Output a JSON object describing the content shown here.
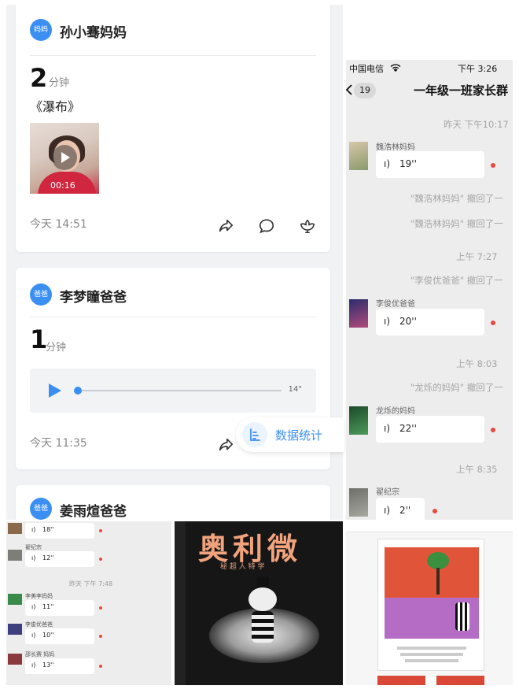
{
  "feed": {
    "posts": [
      {
        "badge": "妈妈",
        "author": "孙小骞妈妈",
        "duration": "2",
        "duration_unit": "分钟",
        "work_title": "《瀑布》",
        "video_time": "00:16",
        "time": "今天 14:51"
      },
      {
        "badge": "爸爸",
        "author": "李梦瞳爸爸",
        "duration": "1",
        "duration_unit": "分钟",
        "audio_length": "14\"",
        "time": "今天 11:35"
      },
      {
        "badge": "爸爸",
        "author": "姜雨煊爸爸"
      }
    ],
    "stats_label": "数据统计"
  },
  "chat": {
    "status": {
      "carrier": "中国电信",
      "time": "下午 3:26"
    },
    "back_count": "19",
    "title": "一年级一班家长群",
    "items": [
      {
        "kind": "time",
        "text": "昨天 下午10:17"
      },
      {
        "kind": "voice",
        "sender": "魏浩林妈妈",
        "seconds": "19''"
      },
      {
        "kind": "system",
        "text": "\"魏浩林妈妈\" 撤回了一"
      },
      {
        "kind": "system",
        "text": "\"魏浩林妈妈\" 撤回了一"
      },
      {
        "kind": "time",
        "text": "上午 7:27"
      },
      {
        "kind": "system",
        "text": "\"李俊优爸爸\" 撤回了一"
      },
      {
        "kind": "voice",
        "sender": "李俊优爸爸",
        "seconds": "20''"
      },
      {
        "kind": "time",
        "text": "上午 8:03"
      },
      {
        "kind": "system",
        "text": "\"龙烁的妈妈\" 撤回了一"
      },
      {
        "kind": "voice",
        "sender": "龙烁的妈妈",
        "seconds": "22''"
      },
      {
        "kind": "time",
        "text": "上午 8:35"
      },
      {
        "kind": "voice",
        "sender": "翟纪宗",
        "seconds": "2''"
      }
    ]
  },
  "mini_chat": {
    "items": [
      {
        "kind": "voice",
        "sender": "",
        "seconds": "18''"
      },
      {
        "kind": "voice",
        "sender": "翟纪宗",
        "seconds": "12''"
      },
      {
        "kind": "time",
        "text": "昨天 下午 7:48"
      },
      {
        "kind": "voice",
        "sender": "李美李妈妈",
        "seconds": "11''"
      },
      {
        "kind": "voice",
        "sender": "李俊优爸爸",
        "seconds": "10''"
      },
      {
        "kind": "voice",
        "sender": "邵长赛 妈妈",
        "seconds": "13''"
      }
    ]
  },
  "book": {
    "title": "奥利微",
    "subtitle": "秘 超 人 特 学"
  },
  "icons": {
    "share": "share-icon",
    "comment": "comment-icon",
    "like": "flower-like-icon",
    "stats": "bar-stats-icon",
    "wifi": "wifi-icon",
    "voice": "voice-wave-icon"
  },
  "colors": {
    "accent": "#3b8ff3",
    "unread_dot": "#e94a3d",
    "chat_bg": "#ededed"
  }
}
